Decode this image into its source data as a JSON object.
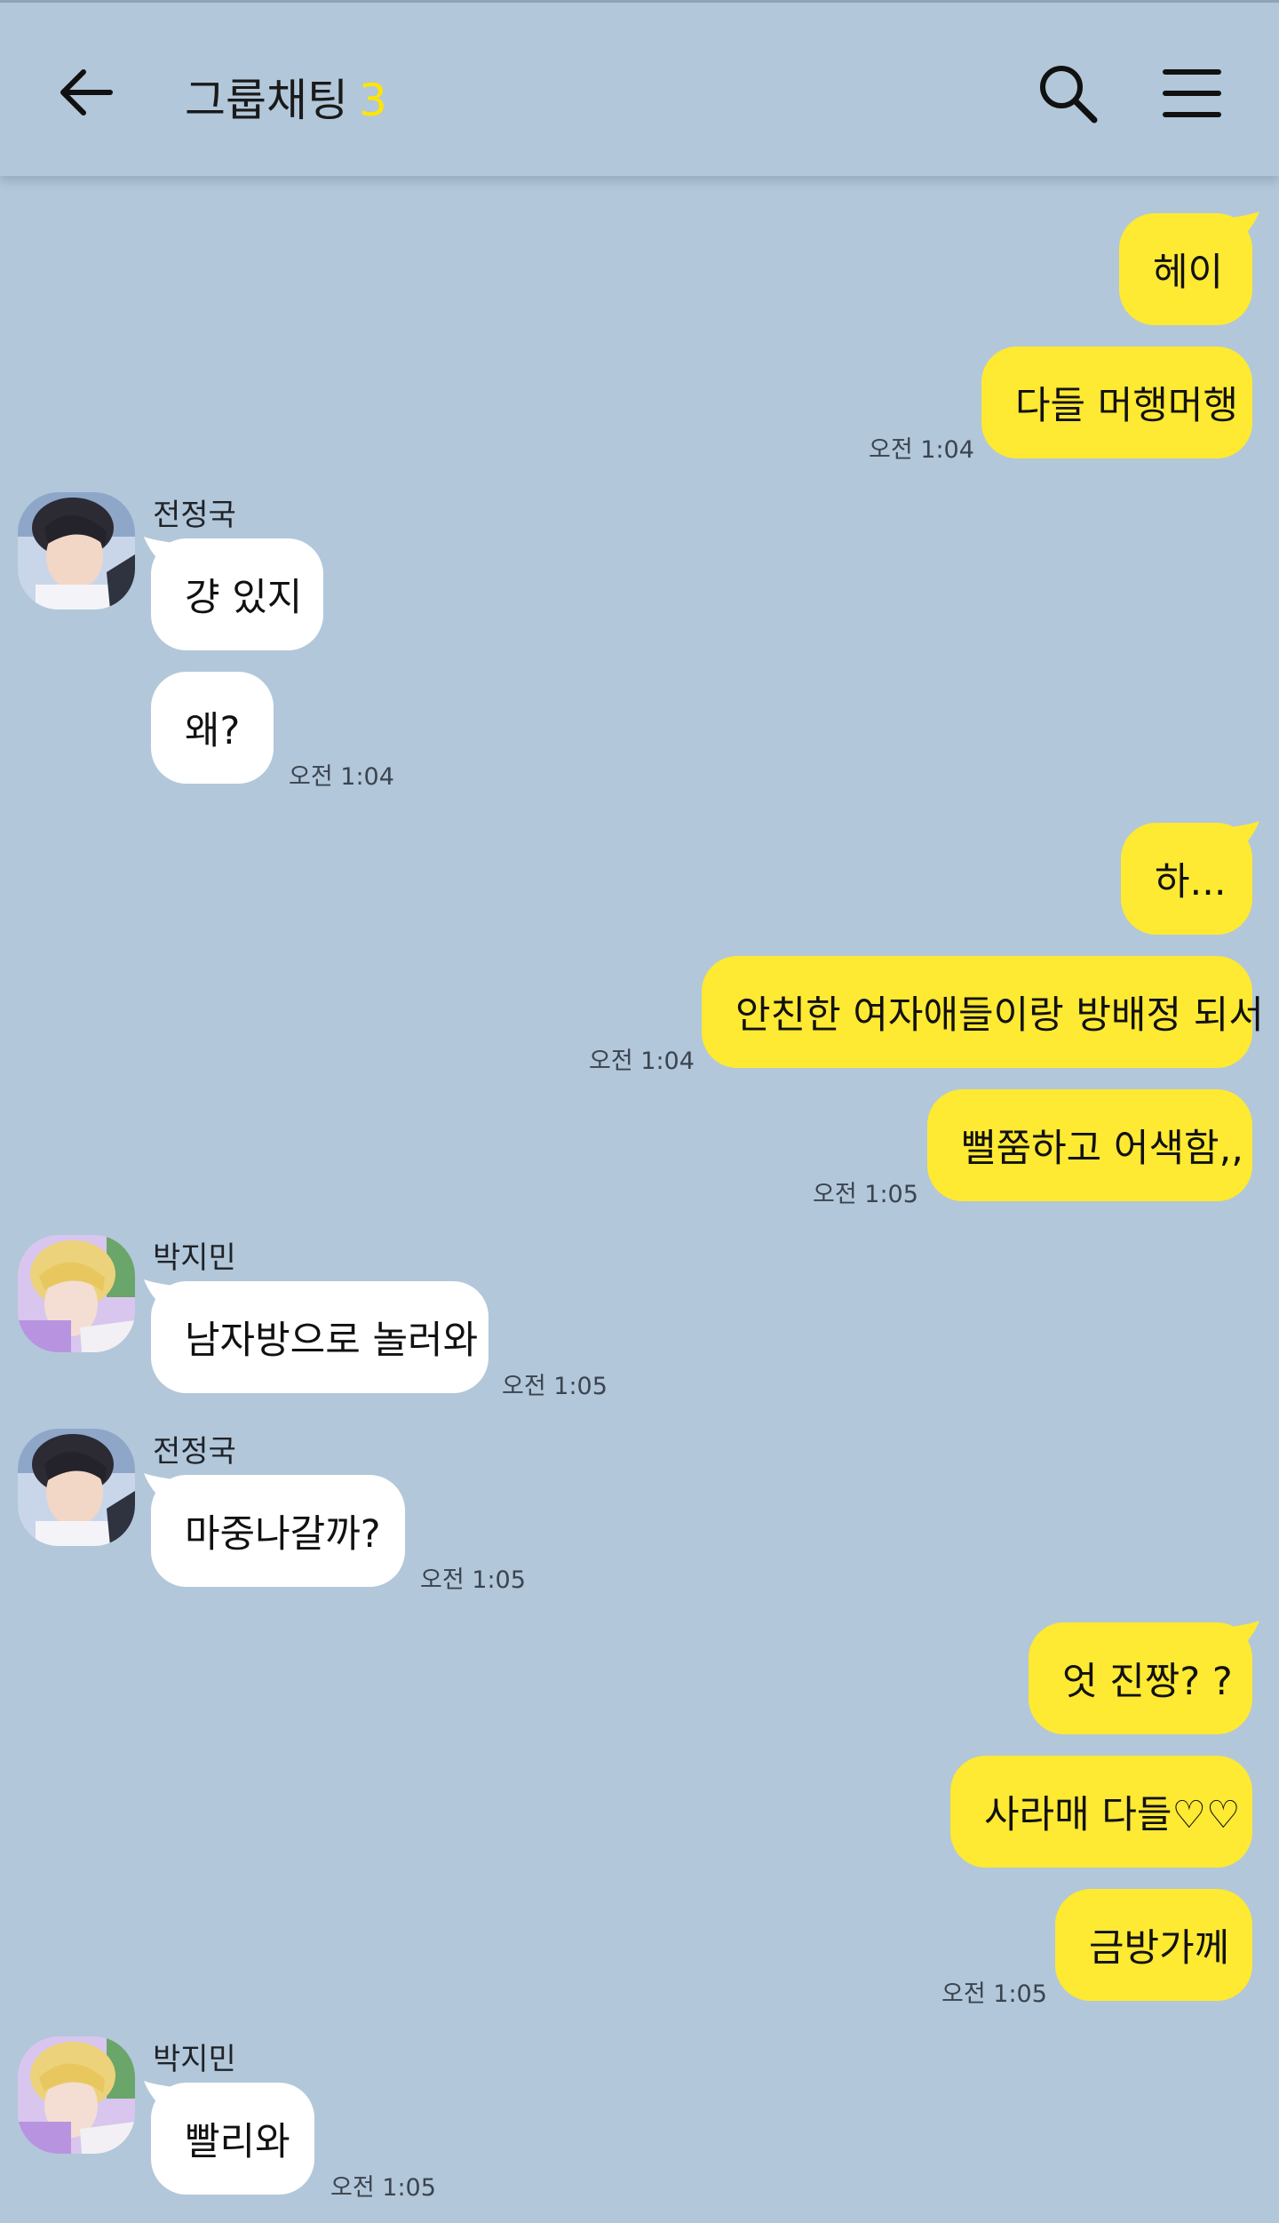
{
  "header": {
    "title": "그룹채팅",
    "member_count": "3",
    "back_icon": "arrow-left-icon",
    "search_icon": "search-icon",
    "menu_icon": "hamburger-menu-icon"
  },
  "colors": {
    "background": "#b2c7d9",
    "my_bubble": "#fee933",
    "their_bubble": "#ffffff",
    "member_count": "#ffe600"
  },
  "messages": [
    {
      "text": "헤이"
    },
    {
      "text": "다들 머행머행",
      "time": "오전 1:04"
    },
    {
      "sender": "전정국",
      "text": "걍 있지"
    },
    {
      "text": "왜?",
      "time": "오전 1:04"
    },
    {
      "text": "하..."
    },
    {
      "text": "안친한 여자애들이랑 방배정 되서",
      "time": "오전 1:04"
    },
    {
      "text": "뻘쭘하고 어색함,,",
      "time": "오전 1:05"
    },
    {
      "sender": "박지민",
      "text": "남자방으로 놀러와",
      "time": "오전 1:05"
    },
    {
      "sender": "전정국",
      "text": "마중나갈까?",
      "time": "오전 1:05"
    },
    {
      "text": "엇 진짱? ?"
    },
    {
      "text": "사라매 다들♡♡"
    },
    {
      "text": "금방가께",
      "time": "오전 1:05"
    },
    {
      "sender": "박지민",
      "text": "빨리와",
      "time": "오전 1:05"
    }
  ]
}
